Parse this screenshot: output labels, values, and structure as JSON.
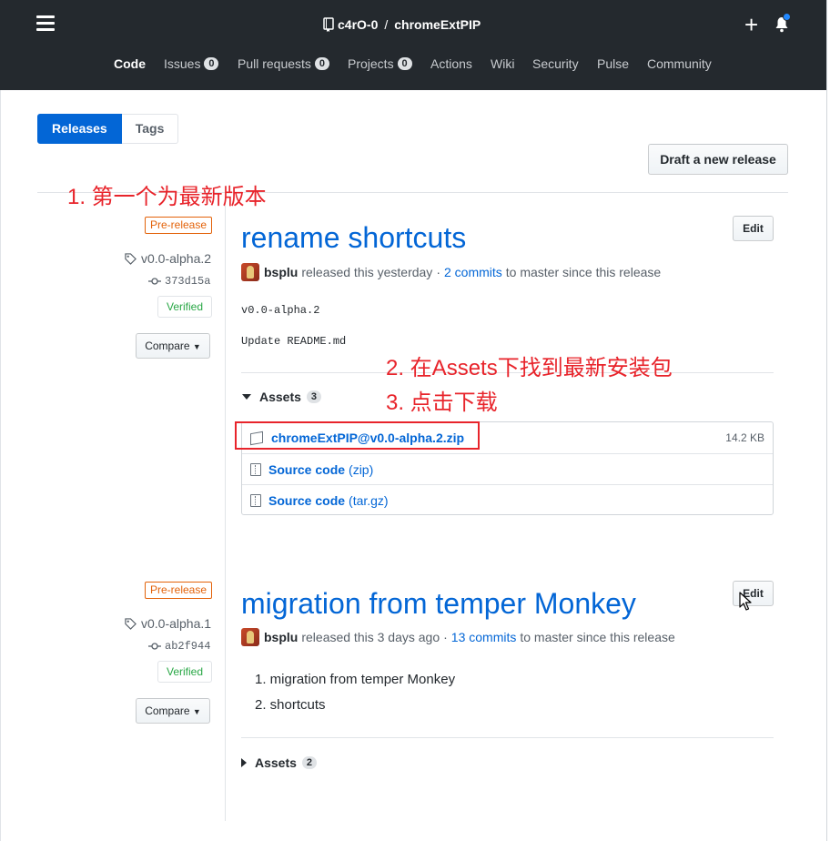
{
  "header": {
    "repo_owner": "c4rO-0",
    "separator": "/",
    "repo_name": "chromeExtPIP",
    "plus_symbol": "+"
  },
  "repo_nav": [
    {
      "label": "Code",
      "count": null,
      "active": true
    },
    {
      "label": "Issues",
      "count": "0"
    },
    {
      "label": "Pull requests",
      "count": "0"
    },
    {
      "label": "Projects",
      "count": "0"
    },
    {
      "label": "Actions",
      "count": null
    },
    {
      "label": "Wiki",
      "count": null
    },
    {
      "label": "Security",
      "count": null
    },
    {
      "label": "Pulse",
      "count": null
    },
    {
      "label": "Community",
      "count": null
    }
  ],
  "subnav": {
    "releases": "Releases",
    "tags": "Tags"
  },
  "draft_button": "Draft a new release",
  "annotations": {
    "step1": "1. 第一个为最新版本",
    "step2": "2. 在Assets下找到最新安装包",
    "step3": "3. 点击下载",
    "highlight_color": "#e8242b"
  },
  "releases": [
    {
      "label": "Pre-release",
      "tag": "v0.0-alpha.2",
      "commit": "373d15a",
      "verified": "Verified",
      "compare": "Compare",
      "title": "rename shortcuts",
      "edit": "Edit",
      "author": "bsplu",
      "released_text": "released this yesterday",
      "dot": "·",
      "commits_link": "2 commits",
      "since_text": "to master since this release",
      "body_lines": [
        "v0.0-alpha.2",
        "Update README.md"
      ],
      "assets_label": "Assets",
      "assets_count": "3",
      "assets": [
        {
          "name": "chromeExtPIP@v0.0-alpha.2.zip",
          "ext": "",
          "size": "14.2 KB"
        },
        {
          "name": "Source code",
          "ext": "(zip)",
          "size": ""
        },
        {
          "name": "Source code",
          "ext": "(tar.gz)",
          "size": ""
        }
      ]
    },
    {
      "label": "Pre-release",
      "tag": "v0.0-alpha.1",
      "commit": "ab2f944",
      "verified": "Verified",
      "compare": "Compare",
      "title": "migration from temper Monkey",
      "edit": "Edit",
      "author": "bsplu",
      "released_text": "released this 3 days ago",
      "dot": "·",
      "commits_link": "13 commits",
      "since_text": "to master since this release",
      "list_items": [
        "1. migration from temper Monkey",
        "2. shortcuts"
      ],
      "assets_label": "Assets",
      "assets_count": "2"
    }
  ],
  "colors": {
    "header_bg": "#24292e",
    "link": "#0366d6",
    "prerelease": "#e36209",
    "verified": "#28a745"
  }
}
